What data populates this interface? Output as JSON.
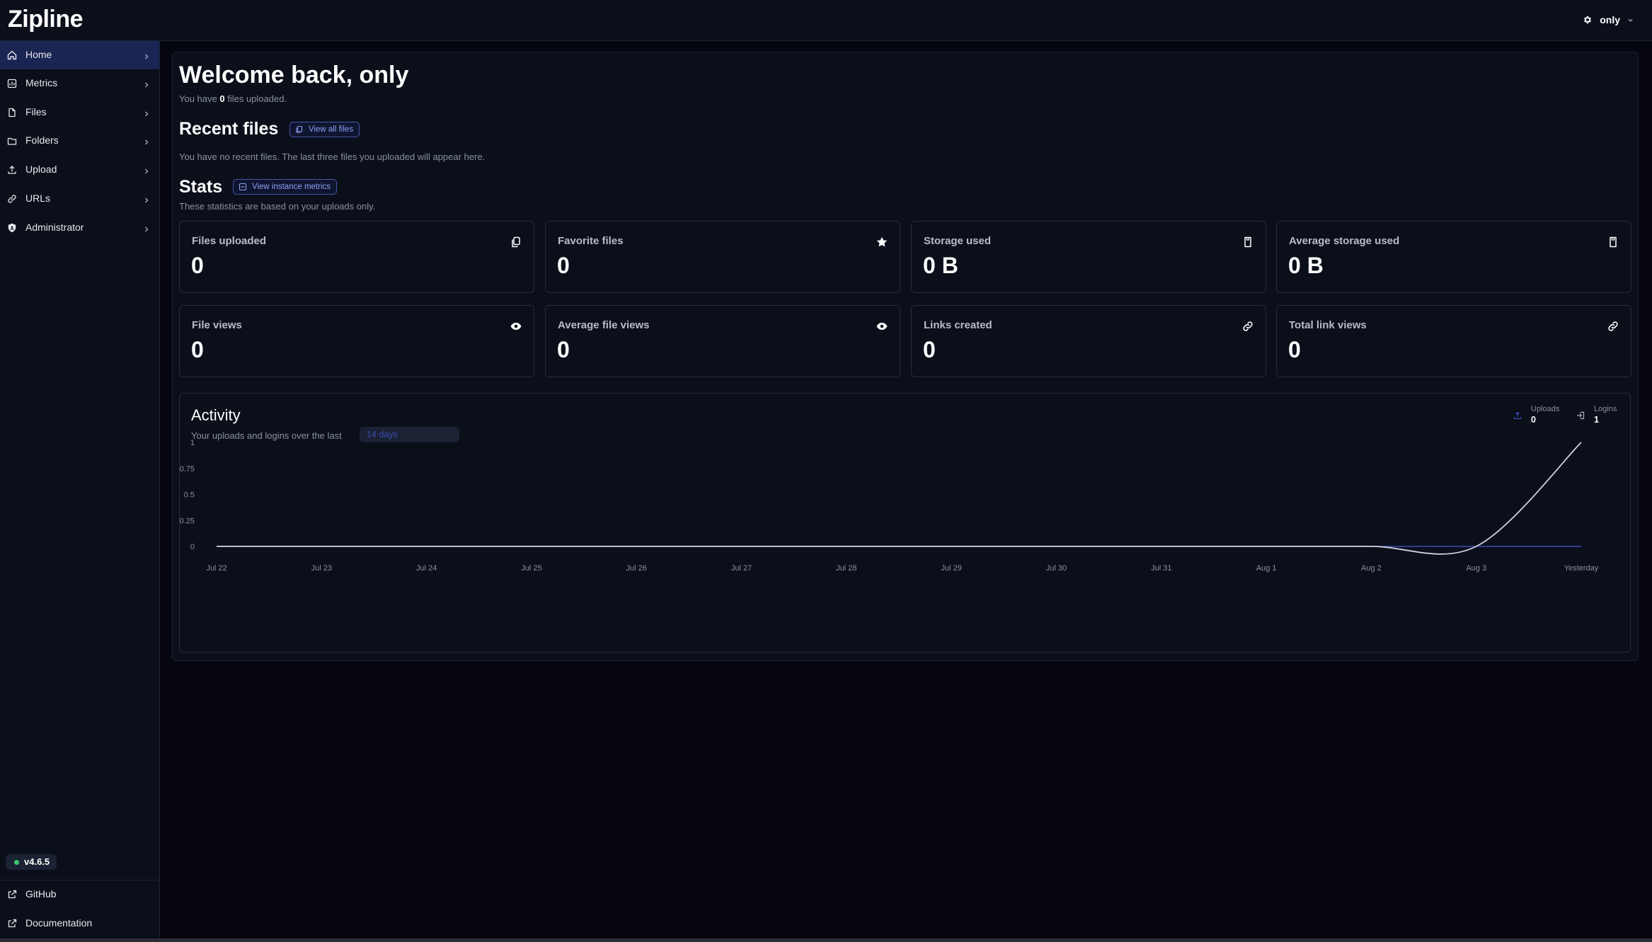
{
  "app": {
    "brand": "Zipline"
  },
  "header": {
    "user_name": "only"
  },
  "sidebar": {
    "items": [
      {
        "label": "Home",
        "icon": "home-icon",
        "active": true
      },
      {
        "label": "Metrics",
        "icon": "metrics-icon",
        "active": false
      },
      {
        "label": "Files",
        "icon": "file-icon",
        "active": false
      },
      {
        "label": "Folders",
        "icon": "folder-icon",
        "active": false
      },
      {
        "label": "Upload",
        "icon": "upload-icon",
        "active": false
      },
      {
        "label": "URLs",
        "icon": "link-icon",
        "active": false
      },
      {
        "label": "Administrator",
        "icon": "shield-icon",
        "active": false
      }
    ],
    "version": "v4.6.5",
    "footer": [
      {
        "label": "GitHub",
        "icon": "external-link-icon"
      },
      {
        "label": "Documentation",
        "icon": "external-link-icon"
      }
    ]
  },
  "welcome": {
    "title": "Welcome back, only",
    "sub_before": "You have",
    "file_count": "0",
    "sub_after": "files uploaded."
  },
  "recent": {
    "title": "Recent files",
    "button": "View all files",
    "empty_text": "You have no recent files. The last three files you uploaded will appear here."
  },
  "stats": {
    "title": "Stats",
    "button": "View instance metrics",
    "subtitle": "These statistics are based on your uploads only.",
    "cards": [
      {
        "label": "Files uploaded",
        "value": "0",
        "icon": "files-icon"
      },
      {
        "label": "Favorite files",
        "value": "0",
        "icon": "star-icon"
      },
      {
        "label": "Storage used",
        "value": "0 B",
        "icon": "storage-icon"
      },
      {
        "label": "Average storage used",
        "value": "0 B",
        "icon": "storage-icon"
      },
      {
        "label": "File views",
        "value": "0",
        "icon": "eye-icon"
      },
      {
        "label": "Average file views",
        "value": "0",
        "icon": "eye-icon"
      },
      {
        "label": "Links created",
        "value": "0",
        "icon": "link-icon"
      },
      {
        "label": "Total link views",
        "value": "0",
        "icon": "link-icon"
      }
    ]
  },
  "activity": {
    "title": "Activity",
    "subtitle": "Your uploads and logins over the last",
    "range": "14 days",
    "legend": [
      {
        "label": "Uploads",
        "value": "0"
      },
      {
        "label": "Logins",
        "value": "1"
      }
    ]
  },
  "colors": {
    "accent": "#3a4bb4",
    "active_nav": "#1b2553",
    "uploads_line": "#3a4bb4",
    "logins_line": "#d0d3da"
  },
  "chart_data": {
    "type": "line",
    "x": [
      "Jul 22",
      "Jul 23",
      "Jul 24",
      "Jul 25",
      "Jul 26",
      "Jul 27",
      "Jul 28",
      "Jul 29",
      "Jul 30",
      "Jul 31",
      "Aug 1",
      "Aug 2",
      "Aug 3",
      "Yesterday"
    ],
    "series": [
      {
        "name": "Uploads",
        "values": [
          0,
          0,
          0,
          0,
          0,
          0,
          0,
          0,
          0,
          0,
          0,
          0,
          0,
          0
        ]
      },
      {
        "name": "Logins",
        "values": [
          0,
          0,
          0,
          0,
          0,
          0,
          0,
          0,
          0,
          0,
          0,
          0,
          0,
          1
        ]
      }
    ],
    "y_ticks": [
      "0",
      "0.25",
      "0.5",
      "0.75",
      "1"
    ],
    "ylim": [
      0,
      1
    ],
    "grid": false,
    "legend": "top-right"
  }
}
